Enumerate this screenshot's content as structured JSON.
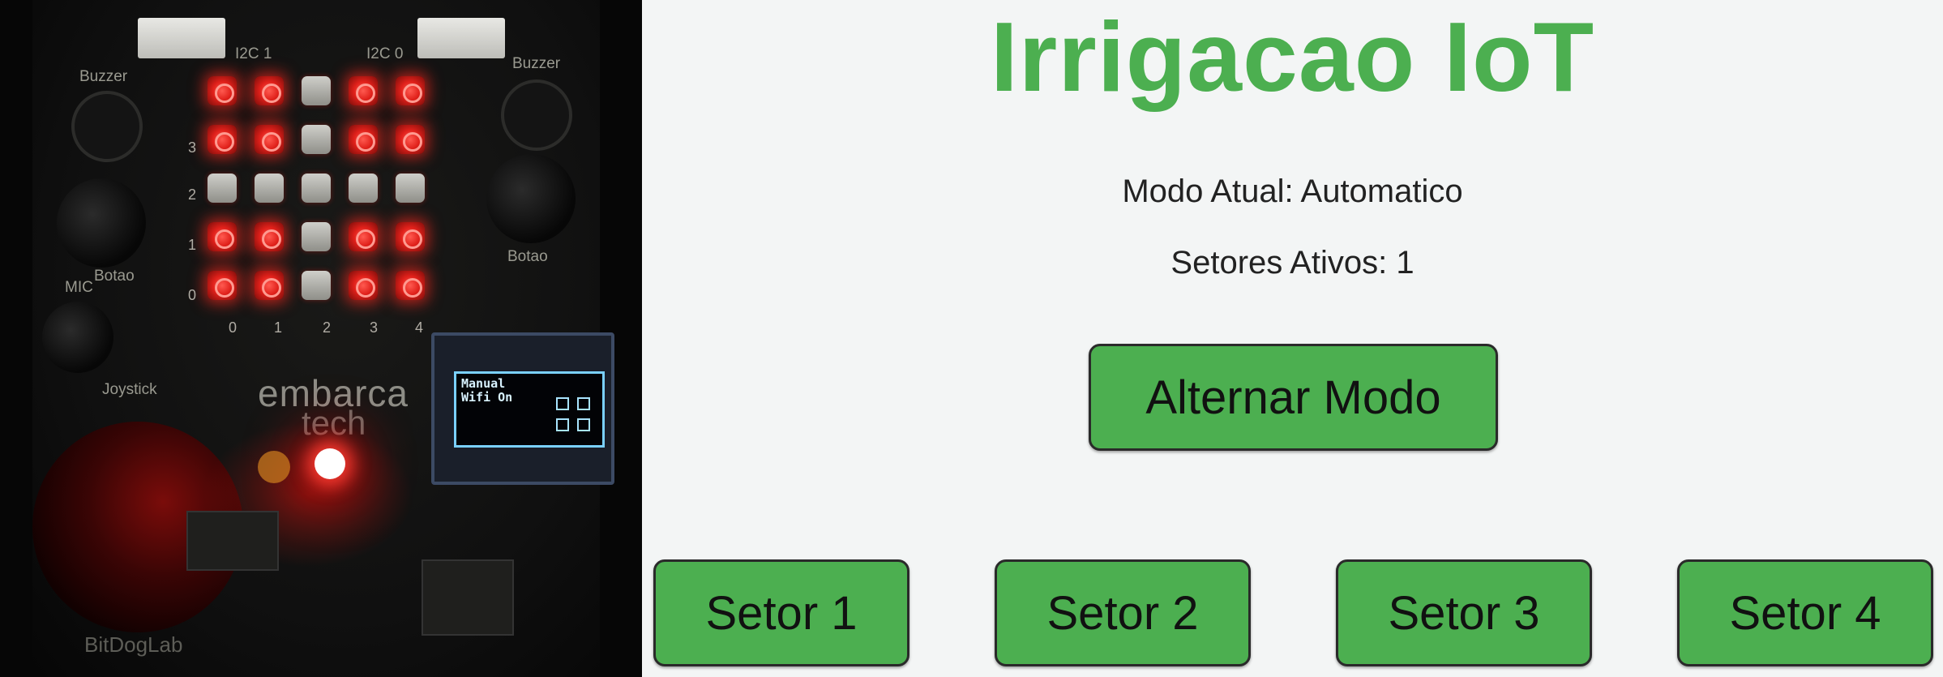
{
  "page": {
    "title": "Irrigacao IoT",
    "modo_label": "Modo Atual:",
    "modo_value": "Automatico",
    "setores_label": "Setores Ativos:",
    "setores_value": "1",
    "toggle_button": "Alternar Modo",
    "sector_buttons": [
      "Setor 1",
      "Setor 2",
      "Setor 3",
      "Setor 4"
    ]
  },
  "colors": {
    "accent": "#4caf50",
    "background": "#f3f5f5",
    "led_on": "#e0201a"
  },
  "photo": {
    "silkscreen": {
      "i2c1": "I2C 1",
      "i2c0": "I2C 0",
      "buzzer_left": "Buzzer",
      "buzzer_right": "Buzzer",
      "botao_left": "Botao",
      "botao_right": "Botao",
      "mic": "MIC",
      "joystick": "Joystick",
      "brand_top": "embarca",
      "brand_bottom": "tech",
      "board_name": "BitDogLab"
    },
    "row_labels": [
      "3",
      "2",
      "1",
      "0"
    ],
    "col_labels": [
      "0",
      "1",
      "2",
      "3",
      "4"
    ],
    "led_matrix": [
      [
        1,
        1,
        0,
        1,
        1
      ],
      [
        1,
        1,
        0,
        1,
        1
      ],
      [
        0,
        0,
        0,
        0,
        0
      ],
      [
        1,
        1,
        0,
        1,
        1
      ],
      [
        1,
        1,
        0,
        1,
        1
      ]
    ],
    "oled": {
      "line1": "Manual",
      "line2": "Wifi On"
    }
  }
}
